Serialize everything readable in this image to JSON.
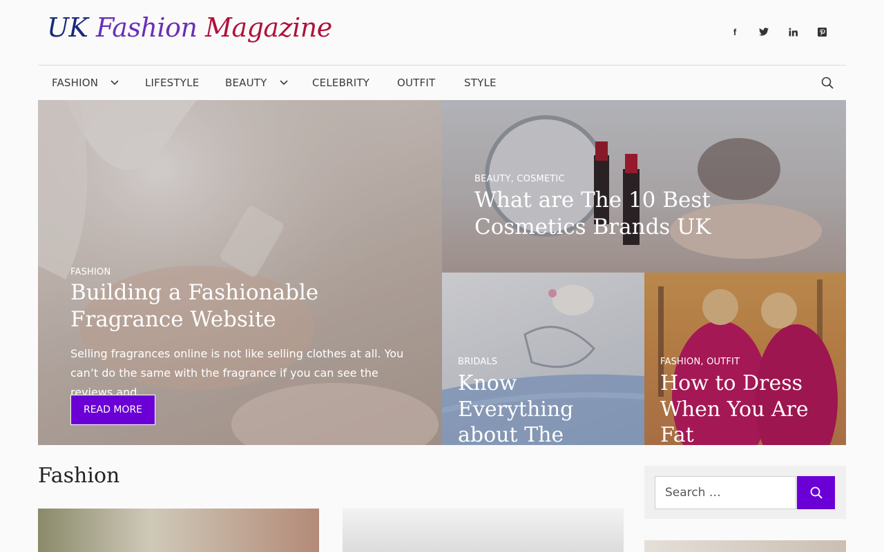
{
  "site": {
    "logo_uk": "UK",
    "logo_fashion": "Fashion",
    "logo_magazine": "Magazine",
    "social": [
      "facebook-icon",
      "twitter-icon",
      "linkedin-icon",
      "pinterest-icon"
    ]
  },
  "nav": {
    "items": [
      {
        "label": "FASHION",
        "has_dropdown": true
      },
      {
        "label": "LIFESTYLE",
        "has_dropdown": false
      },
      {
        "label": "BEAUTY",
        "has_dropdown": true
      },
      {
        "label": "CELEBRITY",
        "has_dropdown": false
      },
      {
        "label": "OUTFIT",
        "has_dropdown": false
      },
      {
        "label": "STYLE",
        "has_dropdown": false
      }
    ]
  },
  "hero": {
    "main": {
      "category": "FASHION",
      "title": "Building a Fashionable Fragrance Website",
      "excerpt": "Selling fragrances online is not like selling clothes at all. You can’t do the same with the fragrance if you can see the reviews and…",
      "button": "READ MORE"
    },
    "top_right": {
      "category_1": "BEAUTY",
      "category_2": "COSMETIC",
      "title": "What are The 10 Best Cosmetics Brands UK"
    },
    "bottom_left": {
      "category": "BRIDALS",
      "title": "Know Everything about The"
    },
    "bottom_right": {
      "category_1": "FASHION",
      "category_2": "OUTFIT",
      "title": "How to Dress When You Are Fat"
    }
  },
  "main": {
    "section_title": "Fashion"
  },
  "sidebar": {
    "search_placeholder": "Search …"
  },
  "colors": {
    "accent": "#6a00d6",
    "logo_blue": "#1a2a7a",
    "logo_purple": "#6a2fb8",
    "logo_red": "#b0123c"
  }
}
